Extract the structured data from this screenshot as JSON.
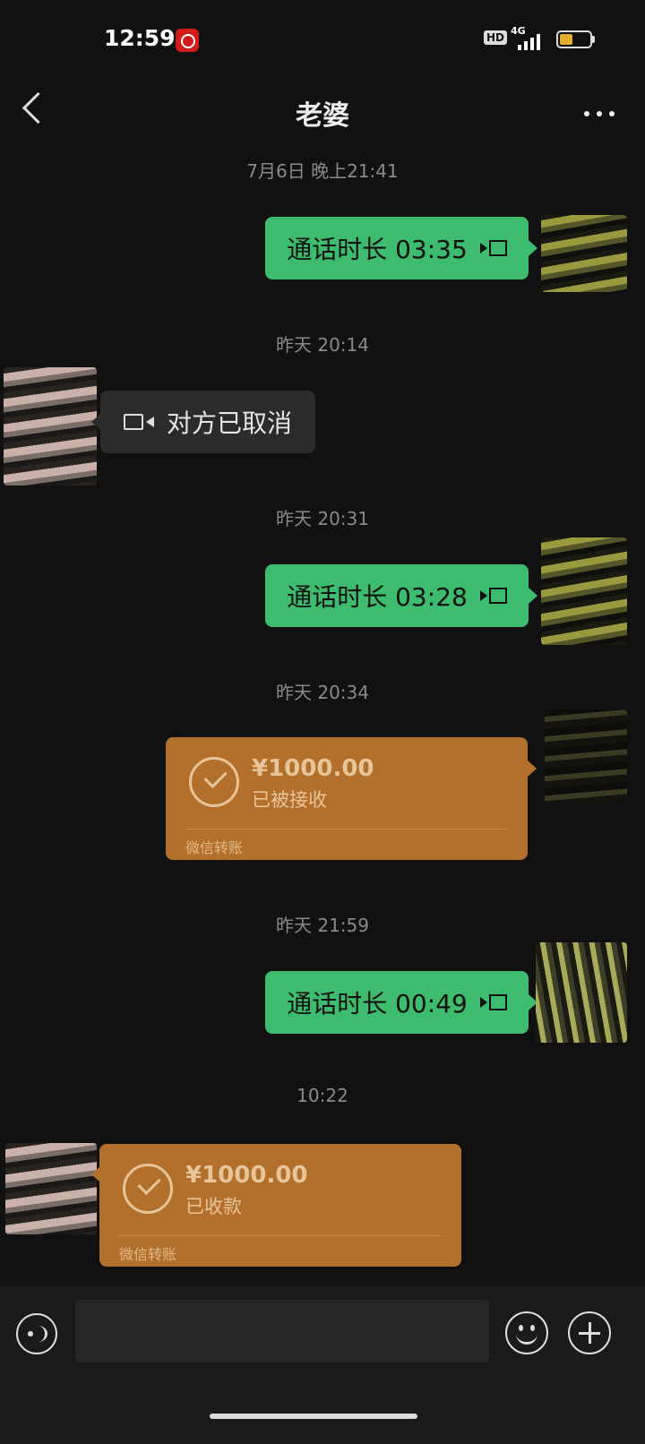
{
  "status_bar": {
    "time": "12:59",
    "hd": "HD",
    "network": "4G",
    "battery_level": 0.45,
    "icons": [
      "app-badge-icon",
      "hd-icon",
      "signal-icon",
      "battery-icon"
    ]
  },
  "header": {
    "title": "老婆",
    "back_icon": "chevron-left-icon",
    "more_icon": "more-dots-icon"
  },
  "messages": [
    {
      "type": "timestamp",
      "text": "7月6日 晚上21:41"
    },
    {
      "type": "call",
      "from": "me",
      "text": "通话时长 03:35",
      "icon": "video-call-icon"
    },
    {
      "type": "timestamp",
      "text": "昨天 20:14"
    },
    {
      "type": "call",
      "from": "them",
      "text": "对方已取消",
      "icon": "video-call-icon"
    },
    {
      "type": "timestamp",
      "text": "昨天 20:31"
    },
    {
      "type": "call",
      "from": "me",
      "text": "通话时长 03:28",
      "icon": "video-call-icon"
    },
    {
      "type": "timestamp",
      "text": "昨天 20:34"
    },
    {
      "type": "transfer",
      "from": "me",
      "amount": "¥1000.00",
      "status": "已被接收",
      "footer": "微信转账"
    },
    {
      "type": "timestamp",
      "text": "昨天 21:59"
    },
    {
      "type": "call",
      "from": "me",
      "text": "通话时长 00:49",
      "icon": "video-call-icon"
    },
    {
      "type": "timestamp",
      "text": "10:22"
    },
    {
      "type": "transfer",
      "from": "them",
      "amount": "¥1000.00",
      "status": "已收款",
      "footer": "微信转账"
    }
  ],
  "input_bar": {
    "input_value": "",
    "voice_icon": "voice-icon",
    "emoji_icon": "emoji-icon",
    "plus_icon": "plus-icon"
  },
  "colors": {
    "background": "#111111",
    "my_bubble": "#3dbb6e",
    "their_bubble": "#2b2b2b",
    "transfer": "#b3702c"
  }
}
